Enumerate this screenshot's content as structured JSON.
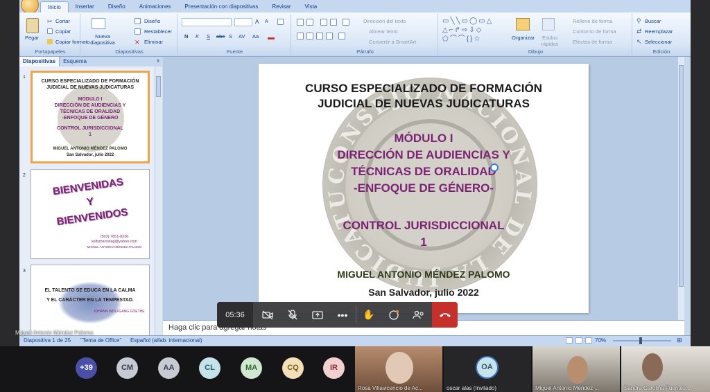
{
  "ribbon": {
    "tabs": [
      "Inicio",
      "Insertar",
      "Diseño",
      "Animaciones",
      "Presentación con diapositivas",
      "Revisar",
      "Vista"
    ],
    "clipboard": {
      "paste": "Pegar",
      "cut": "Cortar",
      "copy": "Copiar",
      "format_painter": "Copiar formato",
      "label": "Portapapeles"
    },
    "slides": {
      "new_slide": "Nueva diapositiva",
      "layout": "Diseño",
      "reset": "Restablecer",
      "delete": "Eliminar",
      "label": "Diapositivas"
    },
    "font": {
      "label": "Fuente",
      "bold": "N",
      "italic": "K",
      "underline": "S",
      "strike": "abe",
      "shadow": "S",
      "spacing": "AV",
      "case": "Aa",
      "grow": "A",
      "shrink": "A"
    },
    "paragraph": {
      "text_direction": "Dirección del texto",
      "align_text": "Alinear texto",
      "smartart": "Convertir a SmartArt",
      "label": "Párrafo"
    },
    "drawing": {
      "arrange": "Organizar",
      "quick_styles": "Estilos rápidos",
      "shape_fill": "Relleno de forma",
      "shape_outline": "Contorno de forma",
      "shape_effects": "Efectos de forma",
      "label": "Dibujo"
    },
    "editing": {
      "find": "Buscar",
      "replace": "Reemplazar",
      "select": "Seleccionar",
      "label": "Edición"
    }
  },
  "panel": {
    "tab_slides": "Diapositivas",
    "tab_outline": "Esquema",
    "close": "x"
  },
  "thumbs": [
    {
      "num": "1",
      "lines": [
        "CURSO ESPECIALIZADO DE FORMACIÓN",
        "JUDICIAL DE NUEVAS JUDICATURAS",
        "MÓDULO I",
        "DIRECCIÓN DE AUDIENCIAS Y",
        "TÉCNICAS DE ORALIDAD",
        "-ENFOQUE DE GÉNERO",
        "CONTROL JURISDICCIONAL",
        "1",
        "MIGUEL ANTONIO MÉNDEZ PALOMO",
        "San Salvador, julio 2022"
      ]
    },
    {
      "num": "2",
      "lines": [
        "BIENVENIDAS",
        "Y",
        "BIENVENIDOS",
        "(503) 7851-8336",
        "kellymarcelag@yahoo.com",
        "MIGUEL ANTONIO MÉNDEZ PALOMO"
      ]
    },
    {
      "num": "3",
      "lines": [
        "EL TALENTO SE EDUCA EN LA CALMA",
        "Y EL CARÁCTER EN LA TEMPESTAD.",
        "JOHANN WOLFGANG GOETHE"
      ]
    }
  ],
  "slide": {
    "title1": "CURSO ESPECIALIZADO DE FORMACIÓN",
    "title2": "JUDICIAL DE NUEVAS JUDICATURAS",
    "module": "MÓDULO I",
    "sub1": "DIRECCIÓN DE AUDIENCIAS Y",
    "sub2": "TÉCNICAS DE ORALIDAD",
    "sub3": "-ENFOQUE DE GÉNERO-",
    "control": "CONTROL JURISDICCIONAL",
    "control_num": "1",
    "author": "MIGUEL ANTONIO MÉNDEZ PALOMO",
    "place": "San Salvador, julio 2022",
    "seal_text": "CONSEJO NACIONAL DE LA JUDICATURA"
  },
  "notes_placeholder": "Haga clic para agregar notas",
  "status": {
    "slide_count": "Diapositiva 1 de 25",
    "theme": "\"Tema de Office\"",
    "language": "Español (alfab. internacional)",
    "zoom": "70%"
  },
  "presenter_label": "Miguel Antonio Méndez Palomo",
  "meeting": {
    "timer": "05:36"
  },
  "participants": [
    {
      "initials": "+39",
      "color": "#4b4fa8",
      "text": "#ffffff"
    },
    {
      "initials": "CM",
      "color": "#c6cad3",
      "text": "#3b3b50"
    },
    {
      "initials": "AA",
      "color": "#c6cad3",
      "text": "#3b3b50"
    },
    {
      "initials": "CL",
      "color": "#c6e3ec",
      "text": "#2b5a68"
    },
    {
      "initials": "MA",
      "color": "#cfe8cf",
      "text": "#2e6a36"
    },
    {
      "initials": "CQ",
      "color": "#f3dfb8",
      "text": "#7a5a1c"
    },
    {
      "initials": "IR",
      "color": "#f3d0d0",
      "text": "#8a2d2d"
    }
  ],
  "tiles": [
    {
      "name": "Rosa Villavicencio de Ac..."
    },
    {
      "name": "oscar alas (Invitado)",
      "initials": "OA"
    },
    {
      "name": "Miguel Antonio Méndez ..."
    },
    {
      "name": "Sandra Carolina Fuentes..."
    }
  ]
}
